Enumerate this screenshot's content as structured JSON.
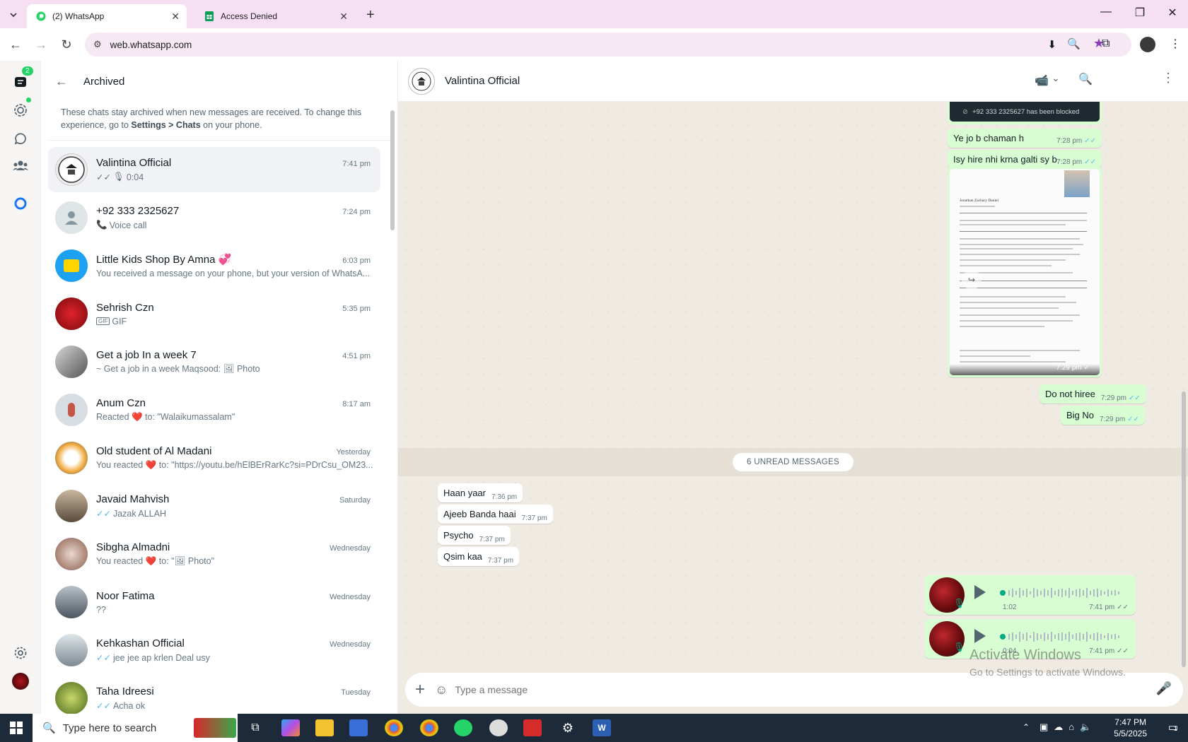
{
  "browser": {
    "tabs": [
      {
        "title": "(2) WhatsApp"
      },
      {
        "title": "Access Denied"
      }
    ],
    "url": "web.whatsapp.com"
  },
  "rail": {
    "chats_badge": "2"
  },
  "archived": {
    "title": "Archived",
    "info_pre": "These chats stay archived when new messages are received. To change this experience, go to ",
    "info_link": "Settings > Chats",
    "info_post": " on your phone."
  },
  "chats": [
    {
      "name": "Valintina Official",
      "time": "7:41 pm",
      "preview": "0:04",
      "avatar_color": "#e9e9e9"
    },
    {
      "name": "+92 333 2325627",
      "time": "7:24 pm",
      "preview": "Voice call",
      "avatar_color": "#dfe5e7"
    },
    {
      "name": "Little Kids Shop By Amna 💞",
      "time": "6:03 pm",
      "preview": "You received a message on your phone, but your version of WhatsA...",
      "avatar_color": "#1da1f2"
    },
    {
      "name": "Sehrish Czn",
      "time": "5:35 pm",
      "preview": "GIF",
      "avatar_color": "#b3141c"
    },
    {
      "name": "Get a job In a week 7",
      "time": "4:51 pm",
      "preview": "~ Get a job in a week Maqsood: 🖼 Photo",
      "avatar_color": "#6b6b6b"
    },
    {
      "name": "Anum Czn",
      "time": "8:17 am",
      "preview": "Reacted ❤️ to: \"Walaikumassalam\"",
      "avatar_color": "#d7dde3"
    },
    {
      "name": "Old student of Al Madani",
      "time": "Yesterday",
      "preview": "You reacted ❤️ to: \"https://youtu.be/hElBErRarKc?si=PDrCsu_OM23...",
      "avatar_color": "#f2a93b"
    },
    {
      "name": "Javaid Mahvish",
      "time": "Saturday",
      "preview": "Jazak ALLAH",
      "avatar_color": "#8a7a6a"
    },
    {
      "name": "Sibgha Almadni",
      "time": "Wednesday",
      "preview": "You reacted ❤️ to: \"🖼 Photo\"",
      "avatar_color": "#9c6b5a"
    },
    {
      "name": "Noor Fatima",
      "time": "Wednesday",
      "preview": "??",
      "avatar_color": "#7a8590"
    },
    {
      "name": "Kehkashan Official",
      "time": "Wednesday",
      "preview": "jee jee ap krlen Deal usy",
      "avatar_color": "#a9b3b8"
    },
    {
      "name": "Taha Idreesi",
      "time": "Tuesday",
      "preview": "Acha ok",
      "avatar_color": "#6b8a3a"
    }
  ],
  "conversation": {
    "name": "Valintina Official",
    "blocked_note": "+92 333 2325627 has been blocked",
    "outgoing": [
      {
        "text": "Ye jo b chaman h",
        "time": "7:28 pm"
      },
      {
        "text": "Isy hire nhi krna galti sy b",
        "time": "7:28 pm"
      },
      {
        "text": "Do not hiree",
        "time": "7:29 pm"
      },
      {
        "text": "Big No",
        "time": "7:29 pm"
      }
    ],
    "image_time": "7:29 pm",
    "doc_title": "Jonathan Zachary Daniel",
    "unread_label": "6 UNREAD MESSAGES",
    "incoming": [
      {
        "text": "Haan yaar",
        "time": "7:36 pm"
      },
      {
        "text": "Ajeeb Banda haai",
        "time": "7:37 pm"
      },
      {
        "text": "Psycho",
        "time": "7:37 pm"
      },
      {
        "text": "Qsim kaa",
        "time": "7:37 pm"
      }
    ],
    "voice": [
      {
        "duration": "1:02",
        "time": "7:41 pm"
      },
      {
        "duration": "0:04",
        "time": "7:41 pm"
      }
    ],
    "input_placeholder": "Type a message"
  },
  "watermark": {
    "title": "Activate Windows",
    "subtitle": "Go to Settings to activate Windows."
  },
  "taskbar": {
    "search_placeholder": "Type here to search",
    "time": "7:47 PM",
    "date": "5/5/2025",
    "notif_count": "1"
  }
}
